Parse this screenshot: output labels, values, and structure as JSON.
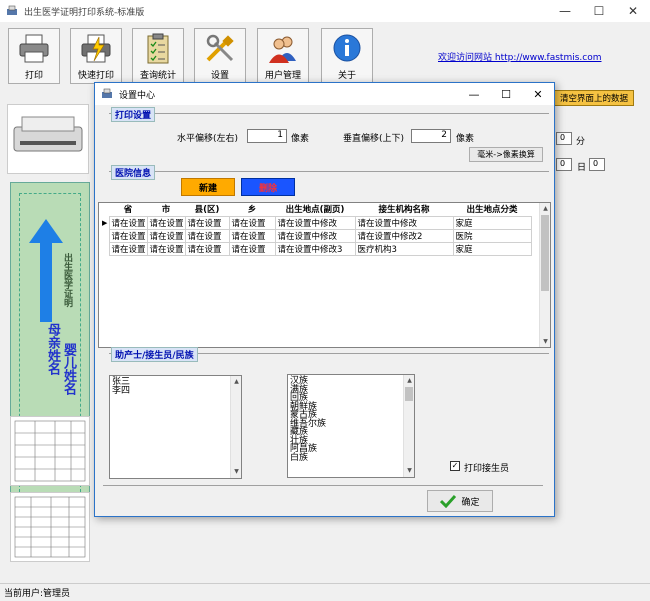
{
  "app": {
    "title": "出生医学证明打印系统-标准版",
    "window_controls": {
      "minimize": "—",
      "maximize": "☐",
      "close": "✕"
    }
  },
  "toolbar": {
    "buttons": [
      {
        "label": "打印",
        "icon": "printer-icon"
      },
      {
        "label": "快速打印",
        "icon": "fast-print-icon"
      },
      {
        "label": "查询统计",
        "icon": "clipboard-icon"
      },
      {
        "label": "设置",
        "icon": "tools-icon"
      },
      {
        "label": "用户管理",
        "icon": "users-icon"
      },
      {
        "label": "关于",
        "icon": "info-icon"
      }
    ],
    "visit_link": "欢迎访问网站 http://www.fastmis.com",
    "clear_button": "清空界面上的数据"
  },
  "background": {
    "fields": [
      {
        "value": "0",
        "label": "分"
      },
      {
        "value": "0",
        "label": "日"
      },
      {
        "value": "0",
        "label": ""
      }
    ],
    "cert_vertical_text_1": "出生医学证明",
    "cert_vertical_text_2": "婴儿姓名",
    "cert_vertical_text_3": "母亲姓名"
  },
  "status": {
    "current_user": "当前用户:管理员"
  },
  "dialog": {
    "title": "设置中心",
    "controls": {
      "minimize": "—",
      "maximize": "☐",
      "close": "✕"
    },
    "print_settings": {
      "title": "打印设置",
      "horizontal_label": "水平偏移(左右)",
      "horizontal_value": "1",
      "horizontal_unit": "像素",
      "vertical_label": "垂直偏移(上下)",
      "vertical_value": "2",
      "vertical_unit": "像素",
      "convert_button": "毫米->像素换算"
    },
    "hospital_info": {
      "title": "医院信息",
      "new_button": "新建",
      "delete_button": "删除",
      "columns": [
        "省",
        "市",
        "县(区)",
        "乡",
        "出生地点(副页)",
        "接生机构名称",
        "出生地点分类"
      ],
      "rows": [
        [
          "请在设置",
          "请在设置",
          "请在设置",
          "请在设置",
          "请在设置中修改",
          "请在设置中修改",
          "家庭"
        ],
        [
          "请在设置",
          "请在设置",
          "请在设置",
          "请在设置",
          "请在设置中修改",
          "请在设置中修改2",
          "医院"
        ],
        [
          "请在设置",
          "请在设置",
          "请在设置",
          "请在设置",
          "请在设置中修改3",
          "医疗机构3",
          "家庭"
        ]
      ]
    },
    "midwife": {
      "title": "助产士/接生员/民族",
      "midwives": [
        "张三",
        "李四"
      ],
      "ethnicities": [
        "汉族",
        "满族",
        "回族",
        "朝鲜族",
        "蒙古族",
        "维吾尔族",
        "藏族",
        "壮族",
        "阿昌族",
        "白族"
      ],
      "print_midwife_label": "打印接生员",
      "print_midwife_checked": true
    },
    "ok_button": "确定"
  }
}
